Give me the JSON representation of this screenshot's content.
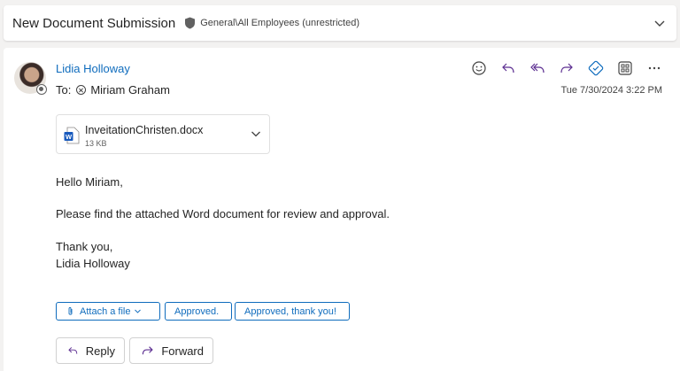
{
  "subject": {
    "title": "New Document Submission",
    "sensitivity": "General\\All Employees (unrestricted)",
    "icons": {
      "sensitivity": "shield-icon",
      "collapse": "chevron-down-icon"
    }
  },
  "message": {
    "sender": "Lidia Holloway",
    "to_prefix": "To:",
    "recipient": "Miriam Graham",
    "date": "Tue 7/30/2024 3:22 PM",
    "actions": [
      "emoji-icon",
      "reply-icon",
      "reply-all-icon",
      "forward-icon",
      "teams-share-icon",
      "apps-icon",
      "more-icon"
    ],
    "more_label": "···"
  },
  "attachment": {
    "name": "InveitationChristen.docx",
    "size": "13 KB"
  },
  "body": {
    "greeting": "Hello Miriam,",
    "line1": "Please find the attached Word document for review and approval.",
    "closing": "Thank you,",
    "signature": "Lidia Holloway"
  },
  "quick_replies": {
    "attach": "Attach a file",
    "approved": "Approved.",
    "approved_thanks": "Approved, thank you!"
  },
  "buttons": {
    "reply": "Reply",
    "forward": "Forward"
  },
  "colors": {
    "accent": "#0f6cbd",
    "background": "#f3f2f1",
    "text": "#242424"
  }
}
